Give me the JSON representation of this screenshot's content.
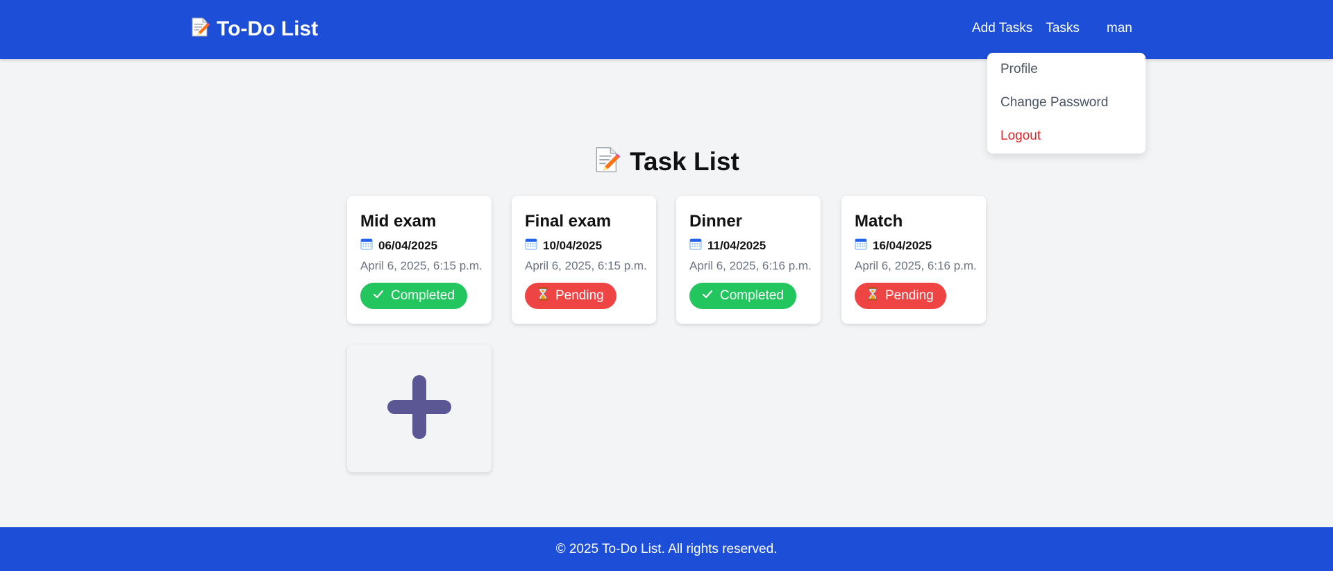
{
  "navbar": {
    "brand_title": "To-Do List",
    "brand_icon": "memo-icon",
    "links": {
      "add_tasks": "Add Tasks",
      "tasks": "Tasks",
      "user": "man"
    },
    "dropdown": {
      "profile": "Profile",
      "change_password": "Change Password",
      "logout": "Logout"
    }
  },
  "main": {
    "title": "Task List",
    "title_icon": "memo-icon",
    "tasks": [
      {
        "title": "Mid exam",
        "due_date": "06/04/2025",
        "created": "April 6, 2025, 6:15 p.m.",
        "status": "Completed",
        "status_icon": "check-icon"
      },
      {
        "title": "Final exam",
        "due_date": "10/04/2025",
        "created": "April 6, 2025, 6:15 p.m.",
        "status": "Pending",
        "status_icon": "hourglass-icon"
      },
      {
        "title": "Dinner",
        "due_date": "11/04/2025",
        "created": "April 6, 2025, 6:16 p.m.",
        "status": "Completed",
        "status_icon": "check-icon"
      },
      {
        "title": "Match",
        "due_date": "16/04/2025",
        "created": "April 6, 2025, 6:16 p.m.",
        "status": "Pending",
        "status_icon": "hourglass-icon"
      }
    ],
    "add_icon": "plus-icon"
  },
  "footer": {
    "text": "© 2025 To-Do List. All rights reserved."
  },
  "colors": {
    "primary": "#1d4ed8",
    "background": "#f3f4f6",
    "completed": "#22c55e",
    "pending": "#ef4444",
    "logout": "#dc2626",
    "plus": "#5b5794"
  }
}
